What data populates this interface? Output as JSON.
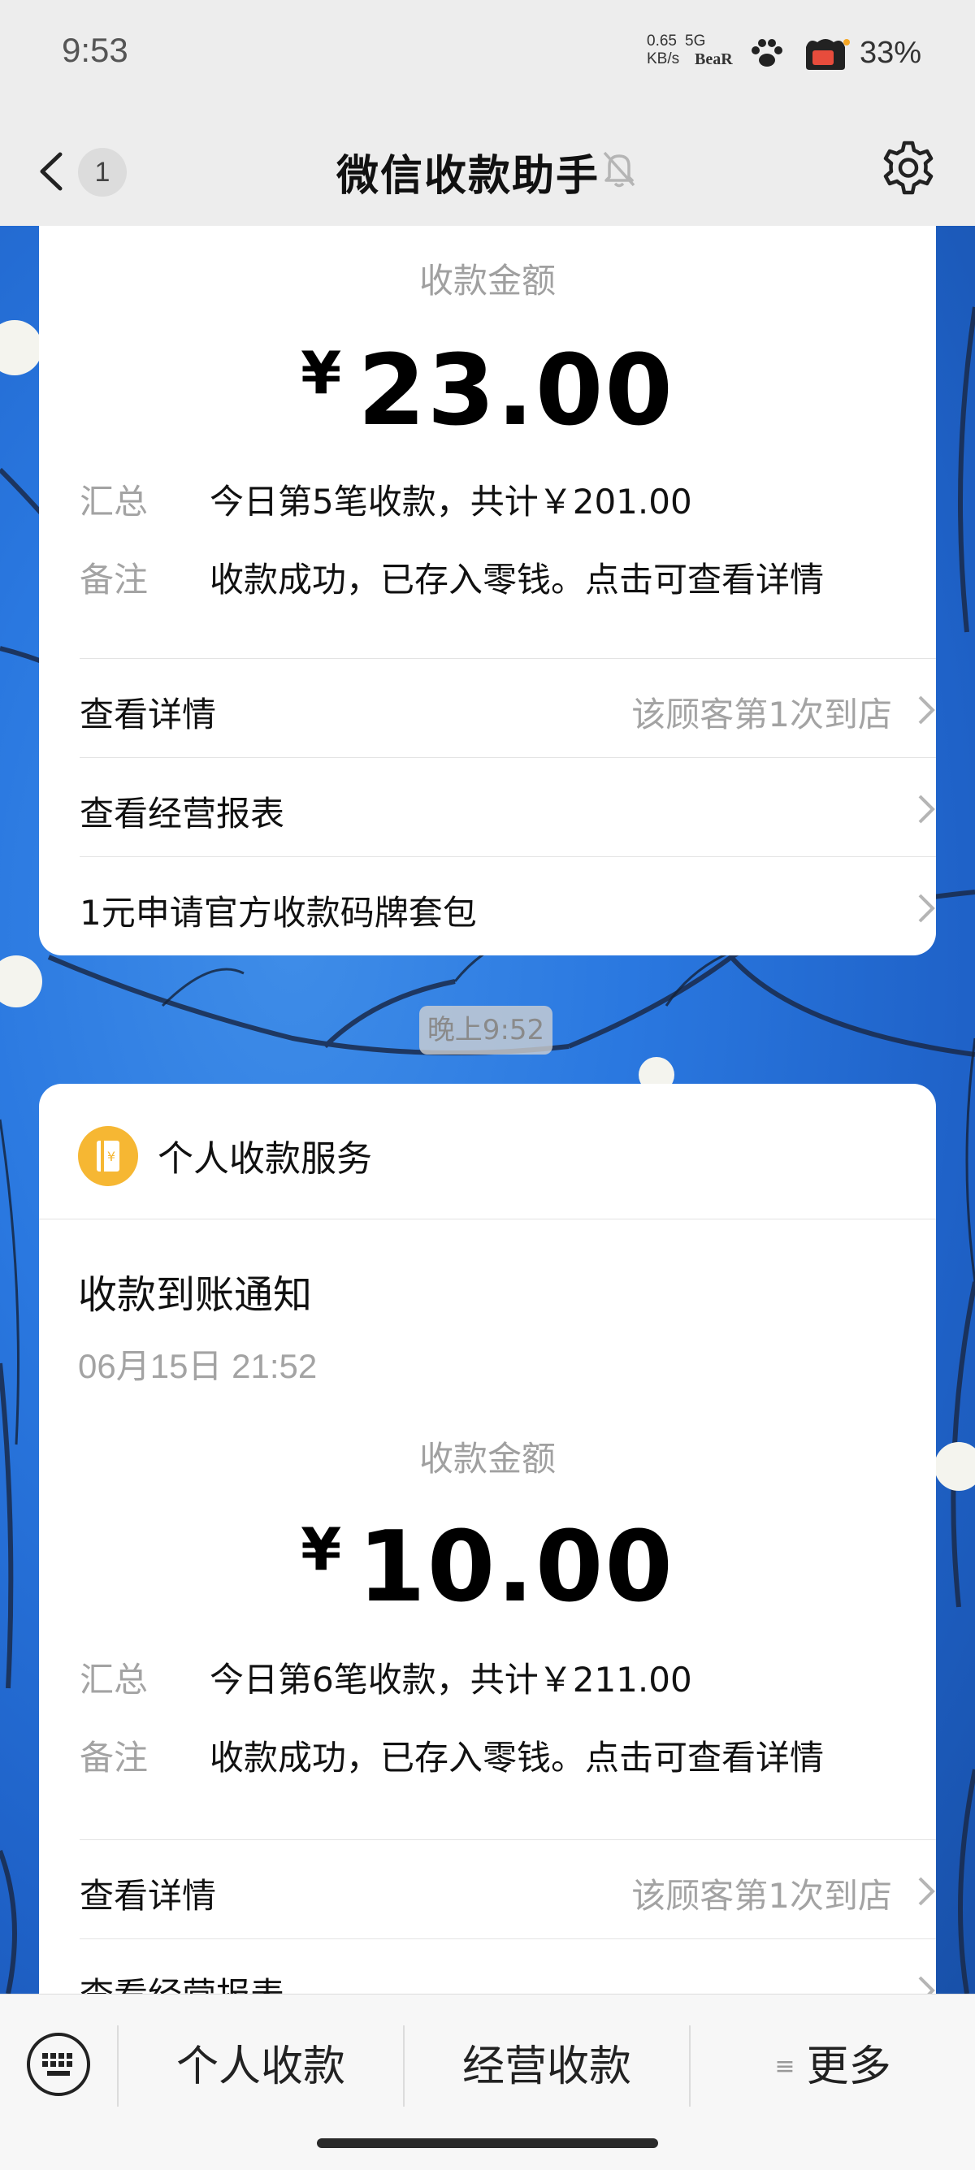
{
  "status_bar": {
    "time": "9:53",
    "net_speed_value": "0.65",
    "net_speed_unit": "KB/s",
    "network": "5G",
    "carrier_badge": "BeaR",
    "battery": "33%"
  },
  "nav": {
    "unread_count": "1",
    "title": "微信收款助手"
  },
  "cards": [
    {
      "amount_label": "收款金额",
      "currency": "¥",
      "amount": "23.00",
      "summary_label": "汇总",
      "summary_value": "今日第5笔收款，共计￥201.00",
      "remark_label": "备注",
      "remark_value": "收款成功，已存入零钱。点击可查看详情",
      "links": [
        {
          "label": "查看详情",
          "hint": "该顾客第1次到店"
        },
        {
          "label": "查看经营报表",
          "hint": ""
        },
        {
          "label": "1元申请官方收款码牌套包",
          "hint": ""
        }
      ]
    },
    {
      "service_name": "个人收款服务",
      "title": "收款到账通知",
      "date": "06月15日 21:52",
      "amount_label": "收款金额",
      "currency": "¥",
      "amount": "10.00",
      "summary_label": "汇总",
      "summary_value": "今日第6笔收款，共计￥211.00",
      "remark_label": "备注",
      "remark_value": "收款成功，已存入零钱。点击可查看详情",
      "links": [
        {
          "label": "查看详情",
          "hint": "该顾客第1次到店"
        },
        {
          "label": "查看经营报表",
          "hint": ""
        }
      ]
    }
  ],
  "time_divider": "晚上9:52",
  "bottom_bar": {
    "tabs": [
      "个人收款",
      "经营收款",
      "更多"
    ]
  },
  "colors": {
    "service_icon": "#f6b733",
    "chat_background": "#2a78e0"
  }
}
